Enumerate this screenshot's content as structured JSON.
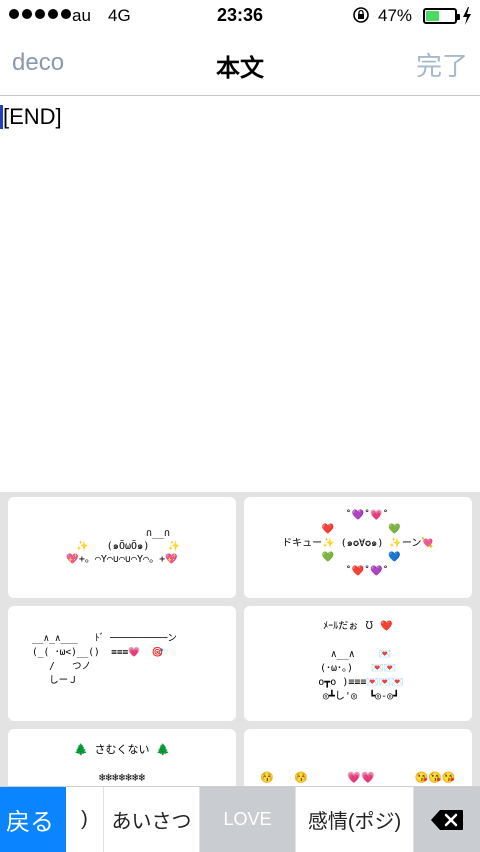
{
  "status_bar": {
    "carrier": "au",
    "network": "4G",
    "time": "23:36",
    "battery_percent": "47%",
    "battery_level": 0.47,
    "icons": [
      "signal-dots",
      "rotation-lock-icon",
      "battery-icon",
      "charging-bolt-icon"
    ]
  },
  "nav": {
    "left_label": "deco",
    "title": "本文",
    "right_label": "完了"
  },
  "editor": {
    "text": "[END]"
  },
  "deco_items": [
    {
      "id": "kaomoji-1",
      "art": "            ∩__∩\n  ✨   (๑ÕωÕ๑)   ✨\n💖+。⌒Y⌒∪⌒∪⌒Y⌒。+💖"
    },
    {
      "id": "kaomoji-2",
      "art": "   ˚💜˚💗˚\n ❤️         💚\nドキュー✨ (๑✪∀✪๑) ✨ーン💘\n 💚         💙\n   ˚❤️˚💜˚"
    },
    {
      "id": "kaomoji-3",
      "art": "__∧_∧___   ﾄﾞ ──────────ン\n(_( ･ω<)__()  ≡≡≡💗  🎯\n   /   つノ\n   しーＪ"
    },
    {
      "id": "kaomoji-4",
      "art": "ﾒｰﾙだぉ ℧ ❤️\n\n ∧__∧    💌\n(･ω･。)   💌💌\n o┳o )≡≡≡💌💌💌\n ◎┻し'◎  ┗◎-◎┛"
    },
    {
      "id": "kaomoji-5",
      "art": "🌲 さむくない 🌲\n\n❄❄❄❄❄❄❄"
    },
    {
      "id": "kaomoji-6",
      "art": "😚   😚      💗💗      😘😘😘"
    }
  ],
  "tabs": {
    "back_label": "戻る",
    "partial_label": ")",
    "greeting_label": "あいさつ",
    "love_label": "LOVE",
    "emotion_label": "感情(ポジ)",
    "delete_icon": "backspace-icon"
  },
  "colors": {
    "accent_blue": "#0a84ff",
    "nav_text": "#8a99ae",
    "battery_green": "#4cd964",
    "panel_bg": "#e3e3e3",
    "selected_tab_bg": "#c9ccd1"
  }
}
